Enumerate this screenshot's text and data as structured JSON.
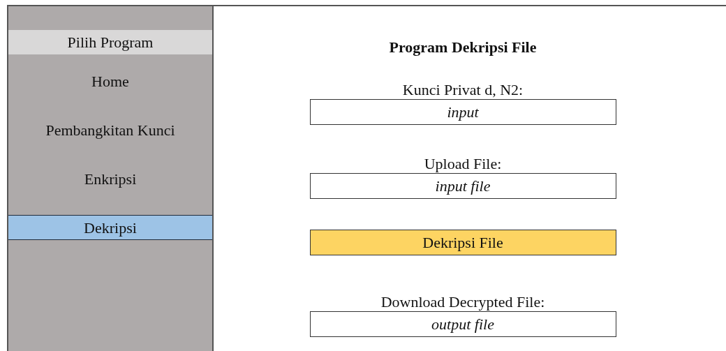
{
  "sidebar": {
    "header": "Pilih Program",
    "items": [
      {
        "label": "Home",
        "selected": false
      },
      {
        "label": "Pembangkitan Kunci",
        "selected": false
      },
      {
        "label": "Enkripsi",
        "selected": false
      },
      {
        "label": "Dekripsi",
        "selected": true
      }
    ]
  },
  "main": {
    "title": "Program Dekripsi File",
    "rows": [
      {
        "kind": "field",
        "label": "Kunci Privat d, N2:",
        "placeholder": "input"
      },
      {
        "kind": "field",
        "label": "Upload File:",
        "placeholder": "input file"
      },
      {
        "kind": "button",
        "label": "Dekripsi File"
      },
      {
        "kind": "field",
        "label": "Download Decrypted File:",
        "placeholder": "output file"
      }
    ]
  }
}
